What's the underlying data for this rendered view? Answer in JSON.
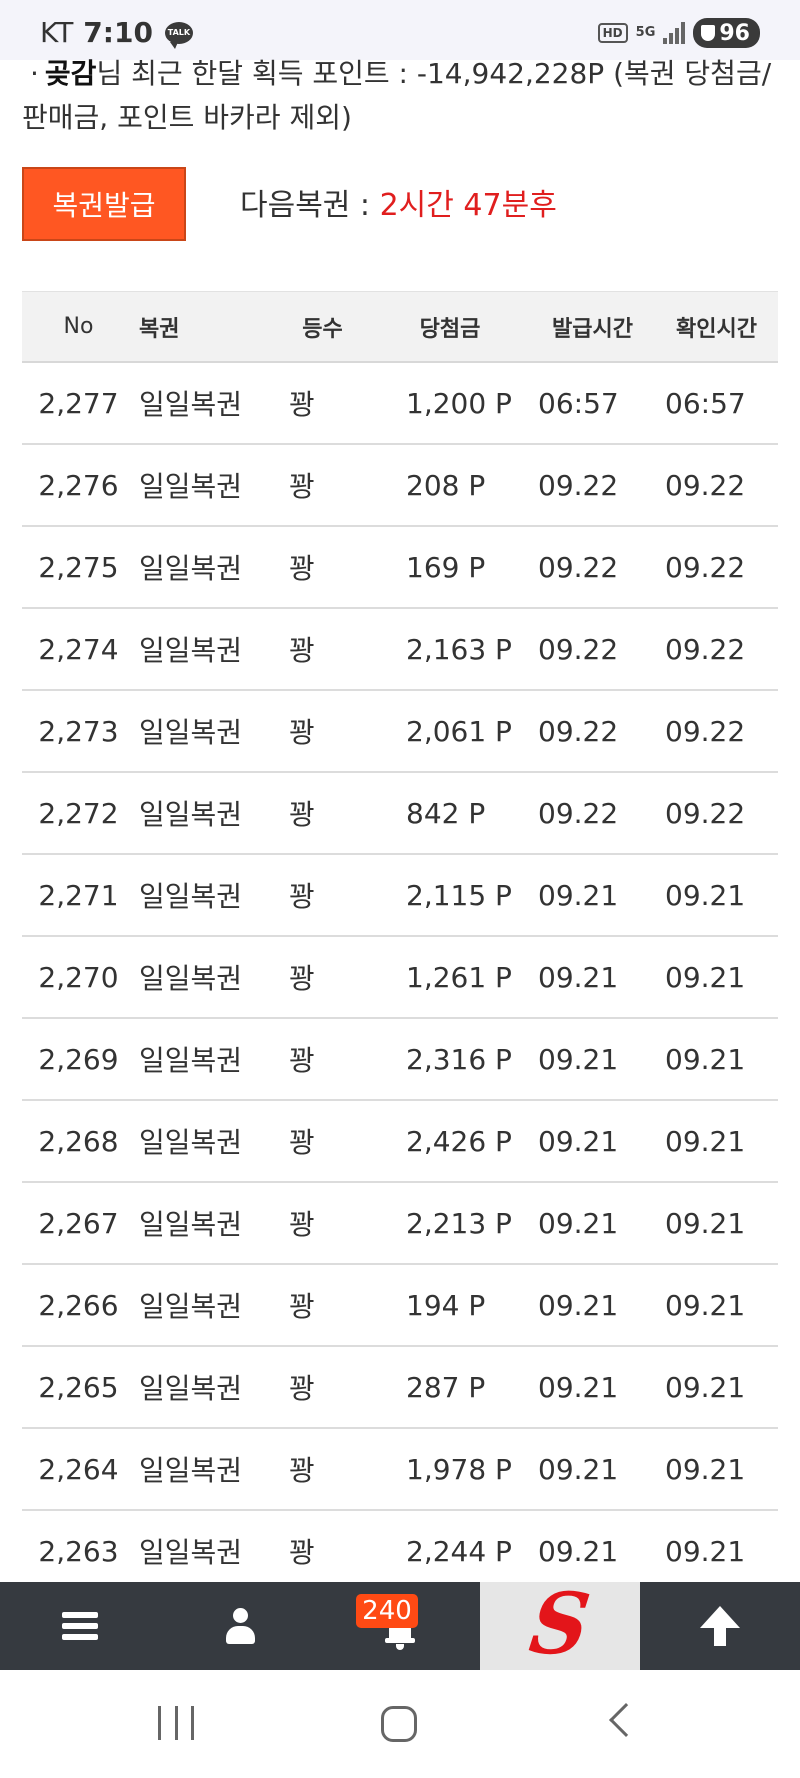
{
  "status_bar": {
    "carrier": "KT",
    "time": "7:10",
    "talk_label": "TALK",
    "hd_label": "HD",
    "network_label": "5G",
    "battery_level": "96"
  },
  "summary": {
    "bullet": "·",
    "user_name": "곶감",
    "text": "님 최근 한달 획득 포인트 : -14,942,228P (복권 당첨금/판매금, 포인트 바카라 제외)"
  },
  "issue_button_label": "복권발급",
  "next_lottery": {
    "label": "다음복권 : ",
    "countdown": "2시간 47분후"
  },
  "table": {
    "headers": {
      "no": "No",
      "name": "복권",
      "rank": "등수",
      "prize": "당첨금",
      "issued": "발급시간",
      "checked": "확인시간"
    },
    "rows": [
      {
        "no": "2,277",
        "name": "일일복권",
        "rank": "꽝",
        "prize": "1,200 P",
        "issued": "06:57",
        "checked": "06:57"
      },
      {
        "no": "2,276",
        "name": "일일복권",
        "rank": "꽝",
        "prize": "208 P",
        "issued": "09.22",
        "checked": "09.22"
      },
      {
        "no": "2,275",
        "name": "일일복권",
        "rank": "꽝",
        "prize": "169 P",
        "issued": "09.22",
        "checked": "09.22"
      },
      {
        "no": "2,274",
        "name": "일일복권",
        "rank": "꽝",
        "prize": "2,163 P",
        "issued": "09.22",
        "checked": "09.22"
      },
      {
        "no": "2,273",
        "name": "일일복권",
        "rank": "꽝",
        "prize": "2,061 P",
        "issued": "09.22",
        "checked": "09.22"
      },
      {
        "no": "2,272",
        "name": "일일복권",
        "rank": "꽝",
        "prize": "842 P",
        "issued": "09.22",
        "checked": "09.22"
      },
      {
        "no": "2,271",
        "name": "일일복권",
        "rank": "꽝",
        "prize": "2,115 P",
        "issued": "09.21",
        "checked": "09.21"
      },
      {
        "no": "2,270",
        "name": "일일복권",
        "rank": "꽝",
        "prize": "1,261 P",
        "issued": "09.21",
        "checked": "09.21"
      },
      {
        "no": "2,269",
        "name": "일일복권",
        "rank": "꽝",
        "prize": "2,316 P",
        "issued": "09.21",
        "checked": "09.21"
      },
      {
        "no": "2,268",
        "name": "일일복권",
        "rank": "꽝",
        "prize": "2,426 P",
        "issued": "09.21",
        "checked": "09.21"
      },
      {
        "no": "2,267",
        "name": "일일복권",
        "rank": "꽝",
        "prize": "2,213 P",
        "issued": "09.21",
        "checked": "09.21"
      },
      {
        "no": "2,266",
        "name": "일일복권",
        "rank": "꽝",
        "prize": "194 P",
        "issued": "09.21",
        "checked": "09.21"
      },
      {
        "no": "2,265",
        "name": "일일복권",
        "rank": "꽝",
        "prize": "287 P",
        "issued": "09.21",
        "checked": "09.21"
      },
      {
        "no": "2,264",
        "name": "일일복권",
        "rank": "꽝",
        "prize": "1,978 P",
        "issued": "09.21",
        "checked": "09.21"
      },
      {
        "no": "2,263",
        "name": "일일복권",
        "rank": "꽝",
        "prize": "2,244 P",
        "issued": "09.21",
        "checked": "09.21"
      }
    ]
  },
  "bottom_nav": {
    "notification_count": "240",
    "logo_letter": "S",
    "icons": [
      "menu-icon",
      "user-icon",
      "bell-icon",
      "logo",
      "up-arrow-icon"
    ]
  },
  "colors": {
    "accent_button": "#ff5722",
    "countdown": "#e01e1e",
    "nav_background": "#363a40",
    "badge": "#ff4a14",
    "logo": "#e3151a"
  }
}
